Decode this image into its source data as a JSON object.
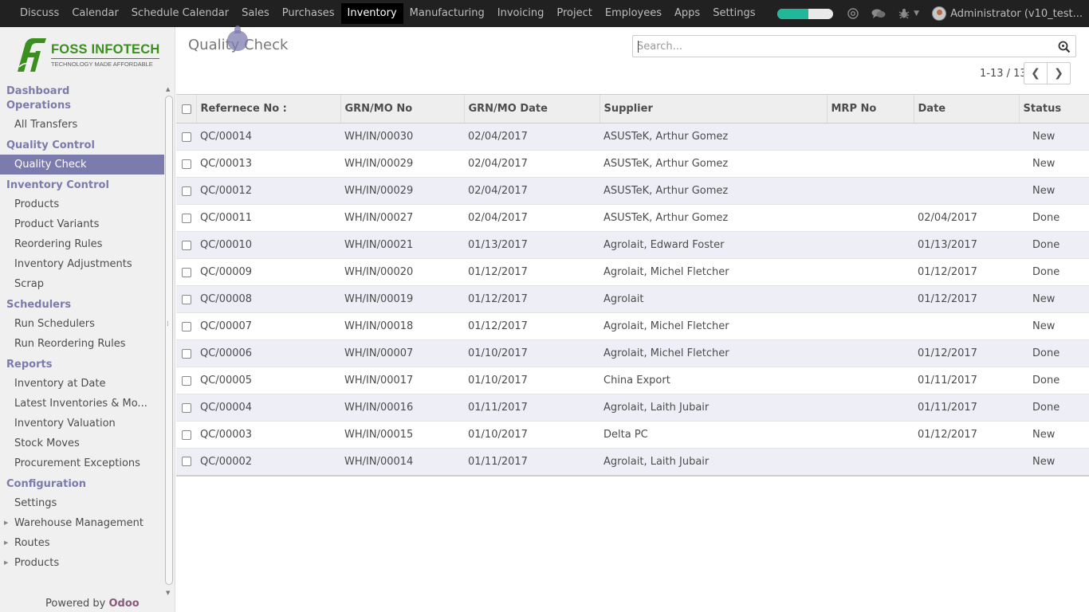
{
  "topmenu": [
    "Discuss",
    "Calendar",
    "Schedule Calendar",
    "Sales",
    "Purchases",
    "Inventory",
    "Manufacturing",
    "Invoicing",
    "Project",
    "Employees",
    "Apps",
    "Settings"
  ],
  "active_menu": "Inventory",
  "onboarding_progress": 0.55,
  "user": {
    "label": "Administrator (v10_test..."
  },
  "icons": {
    "mention": "at-icon",
    "chat": "chat-icon",
    "debug": "bug-icon",
    "search": "magnifier-icon"
  },
  "logo": {
    "name": "FOSS INFOTECH",
    "tagline": "TECHNOLOGY MADE AFFORDABLE"
  },
  "sidebar": {
    "sections": [
      {
        "title": "Dashboard Operations",
        "items": [
          "All Transfers"
        ]
      },
      {
        "title": "Quality Control",
        "items": [
          "Quality Check"
        ]
      },
      {
        "title": "Inventory Control",
        "items": [
          "Products",
          "Product Variants",
          "Reordering Rules",
          "Inventory Adjustments",
          "Scrap"
        ]
      },
      {
        "title": "Schedulers",
        "items": [
          "Run Schedulers",
          "Run Reordering Rules"
        ]
      },
      {
        "title": "Reports",
        "items": [
          "Inventory at Date",
          "Latest Inventories & Mo...",
          "Inventory Valuation",
          "Stock Moves",
          "Procurement Exceptions"
        ]
      },
      {
        "title": "Configuration",
        "items": [
          "Settings",
          "Warehouse Management",
          "Routes",
          "Products"
        ]
      }
    ],
    "active_item": "Quality Check",
    "powered_by": "Powered by",
    "powered_brand": "Odoo"
  },
  "page": {
    "title": "Quality Check",
    "search_placeholder": "Search...",
    "pager": "1-13 / 13"
  },
  "table": {
    "columns": [
      "Refernece No :",
      "GRN/MO No",
      "GRN/MO Date",
      "Supplier",
      "MRP No",
      "Date",
      "Status"
    ],
    "rows": [
      [
        "QC/00014",
        "WH/IN/00030",
        "02/04/2017",
        "ASUSTeK, Arthur Gomez",
        "",
        "",
        "New"
      ],
      [
        "QC/00013",
        "WH/IN/00029",
        "02/04/2017",
        "ASUSTeK, Arthur Gomez",
        "",
        "",
        "New"
      ],
      [
        "QC/00012",
        "WH/IN/00029",
        "02/04/2017",
        "ASUSTeK, Arthur Gomez",
        "",
        "",
        "New"
      ],
      [
        "QC/00011",
        "WH/IN/00027",
        "02/04/2017",
        "ASUSTeK, Arthur Gomez",
        "",
        "02/04/2017",
        "Done"
      ],
      [
        "QC/00010",
        "WH/IN/00021",
        "01/13/2017",
        "Agrolait, Edward Foster",
        "",
        "01/13/2017",
        "Done"
      ],
      [
        "QC/00009",
        "WH/IN/00020",
        "01/12/2017",
        "Agrolait, Michel Fletcher",
        "",
        "01/12/2017",
        "Done"
      ],
      [
        "QC/00008",
        "WH/IN/00019",
        "01/12/2017",
        "Agrolait",
        "",
        "01/12/2017",
        "New"
      ],
      [
        "QC/00007",
        "WH/IN/00018",
        "01/12/2017",
        "Agrolait, Michel Fletcher",
        "",
        "",
        "New"
      ],
      [
        "QC/00006",
        "WH/IN/00007",
        "01/10/2017",
        "Agrolait, Michel Fletcher",
        "",
        "01/12/2017",
        "Done"
      ],
      [
        "QC/00005",
        "WH/IN/00017",
        "01/10/2017",
        "China Export",
        "",
        "01/11/2017",
        "Done"
      ],
      [
        "QC/00004",
        "WH/IN/00016",
        "01/11/2017",
        "Agrolait, Laith Jubair",
        "",
        "01/11/2017",
        "Done"
      ],
      [
        "QC/00003",
        "WH/IN/00015",
        "01/10/2017",
        "Delta PC",
        "",
        "01/12/2017",
        "New"
      ],
      [
        "QC/00002",
        "WH/IN/00014",
        "01/11/2017",
        "Agrolait, Laith Jubair",
        "",
        "",
        "New"
      ]
    ]
  }
}
